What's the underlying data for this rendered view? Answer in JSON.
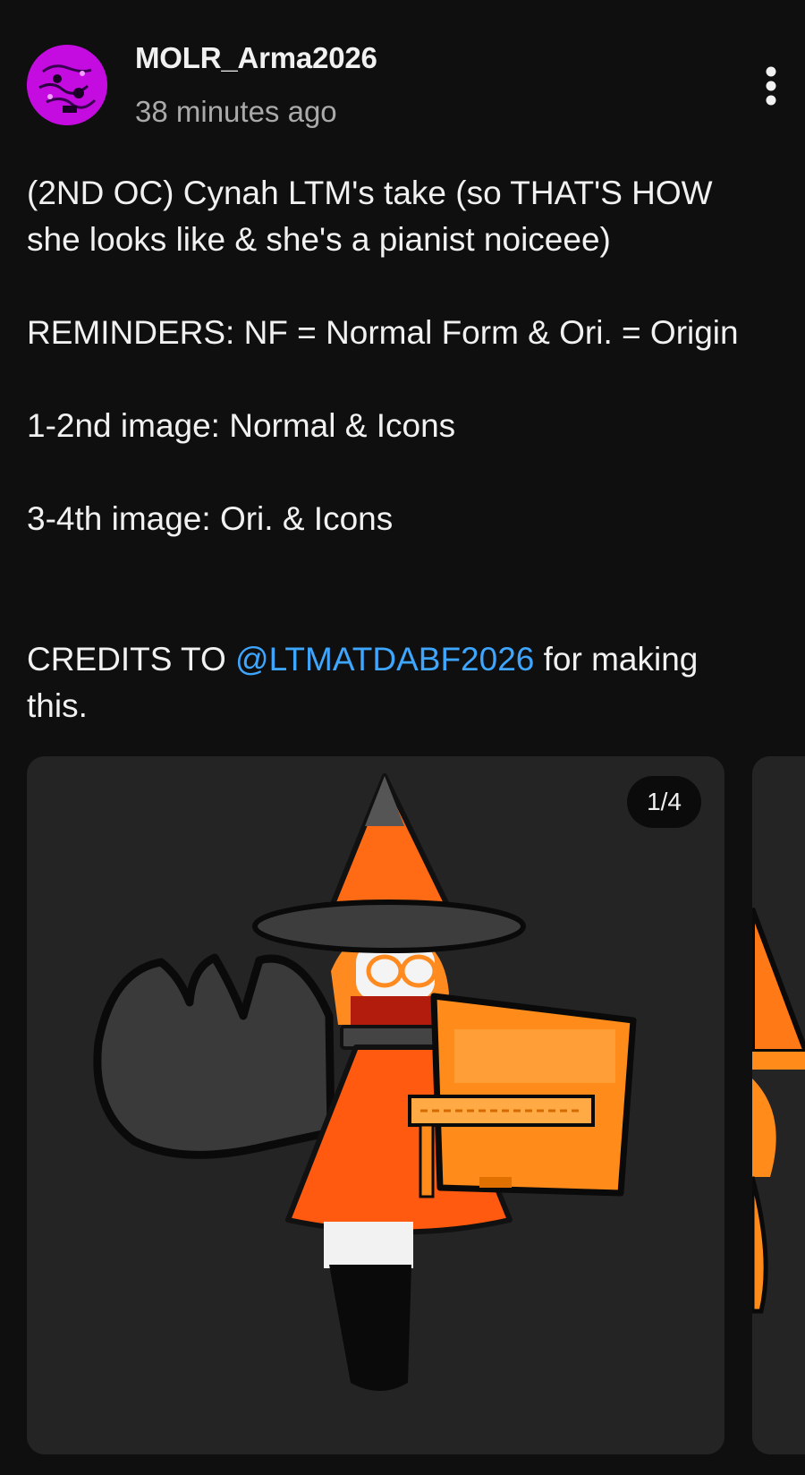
{
  "post": {
    "author": "MOLR_Arma2026",
    "timestamp": "38 minutes ago",
    "more_icon": "vertical-ellipsis-icon",
    "avatar_icon": "profile-avatar",
    "body": {
      "line1": "(2ND OC) Cynah LTM's take (so THAT'S HOW",
      "line2": "she looks like & she's a pianist noiceee)",
      "line3": "REMINDERS: NF = Normal Form & Ori. = Origin",
      "line4": "1-2nd image: Normal & Icons",
      "line5": "3-4th image: Ori. & Icons",
      "credits_prefix": "CREDITS TO ",
      "credits_mention": "@LTMATDABF2026",
      "credits_suffix": " for making",
      "credits_line2": "this."
    }
  },
  "carousel": {
    "counter": "1/4",
    "current": 1,
    "total": 4
  },
  "colors": {
    "background": "#0f0f0f",
    "mention": "#3ea6ff",
    "secondary_text": "#aaaaaa",
    "card": "#242424"
  }
}
